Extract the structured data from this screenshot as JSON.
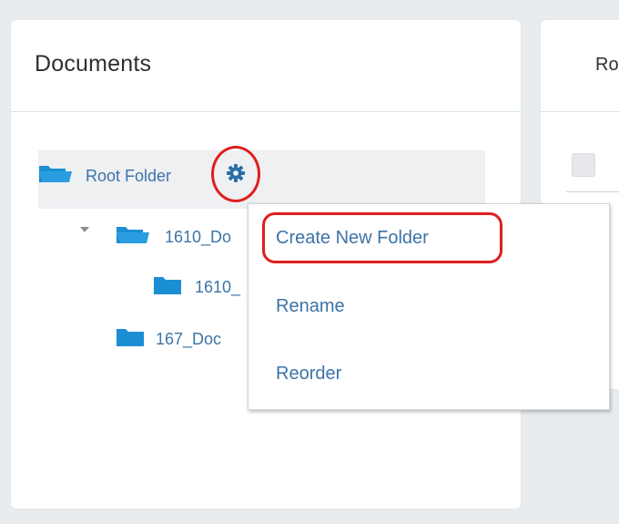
{
  "documents_panel": {
    "title": "Documents"
  },
  "right_panel": {
    "title_fragment": "Ro"
  },
  "tree": {
    "root": {
      "label": "Root Folder",
      "icon": "open-folder-icon"
    },
    "items": [
      {
        "label": "1610_Do",
        "icon": "open-folder-icon",
        "expanded": true
      },
      {
        "label": "1610_",
        "icon": "folder-icon"
      },
      {
        "label": "167_Doc",
        "icon": "folder-icon"
      }
    ],
    "settings_icon": "gear-icon"
  },
  "context_menu": {
    "items": [
      {
        "label": "Create New Folder"
      },
      {
        "label": "Rename"
      },
      {
        "label": "Reorder"
      }
    ]
  },
  "colors": {
    "link": "#3d73a8",
    "folder": "#1a8fd3",
    "annotation": "#e01e1e",
    "background": "#e9ecef"
  }
}
